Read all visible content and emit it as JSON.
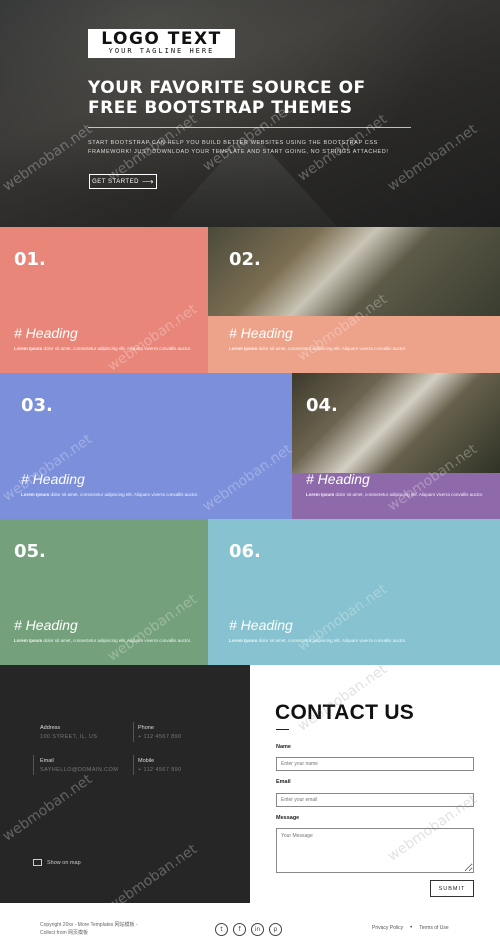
{
  "hero": {
    "logo_main": "LOGO TEXT",
    "logo_tagline": "YOUR TAGLINE HERE",
    "headline": "YOUR FAVORITE SOURCE OF FREE BOOTSTRAP THEMES",
    "description": "START BOOTSTRAP CAN HELP YOU BUILD BETTER WEBSITES USING THE BOOTSTRAP CSS FRAMEWORK! JUST DOWNLOAD YOUR TEMPLATE AND START GOING, NO STRINGS ATTACHED!",
    "cta_label": "GET STARTED",
    "cta_icon": "arrow-right-icon"
  },
  "tiles": [
    {
      "number": "01.",
      "heading": "# Heading",
      "lead": "Lorem Ipsum",
      "text": "dolor sit amet, consectetur adipiscing elit. Aliquam viverra convallis auctor.",
      "color": "#e9867a"
    },
    {
      "number": "02.",
      "heading": "# Heading",
      "lead": "Lorem Ipsum",
      "text": "dolor sit amet, consectetur adipiscing elit. Aliquam viverra convallis auctor.",
      "color": "#eda28a"
    },
    {
      "number": "03.",
      "heading": "# Heading",
      "lead": "Lorem Ipsum",
      "text": "dolor sit amet, consectetur adipiscing elit. Aliquam viverra convallis auctor.",
      "color": "#7b8fdb"
    },
    {
      "number": "04.",
      "heading": "# Heading",
      "lead": "Lorem Ipsum",
      "text": "dolor sit amet, consectetur adipiscing elit. Aliquam viverra convallis auctor.",
      "color": "#8e6aaa"
    },
    {
      "number": "05.",
      "heading": "# Heading",
      "lead": "Lorem Ipsum",
      "text": "dolor sit amet, consectetur adipiscing elit. Aliquam viverra convallis auctor.",
      "color": "#74a07b"
    },
    {
      "number": "06.",
      "heading": "# Heading",
      "lead": "Lorem Ipsum",
      "text": "dolor sit amet, consectetur adipiscing elit. Aliquam viverra convallis auctor.",
      "color": "#86c2cf"
    }
  ],
  "contact_info": {
    "address_label": "Address",
    "address_value": "100 STREET, IL, US",
    "phone_label": "Phone",
    "phone_value": "+ 112 4567 890",
    "email_label": "Email",
    "email_value": "SAYHELLO@DOMAIN.COM",
    "mobile_label": "Mobile",
    "mobile_value": "+ 112 4567 890",
    "show_map_label": "Show on map"
  },
  "contact_form": {
    "title": "CONTACT US",
    "name_label": "Name",
    "name_placeholder": "Enter your name",
    "email_label": "Email",
    "email_placeholder": "Enter your email",
    "message_label": "Message",
    "message_placeholder": "Your Message",
    "submit_label": "SUBMIT"
  },
  "footer": {
    "copyright": "Copyright 20xx - More Templates 网站模板 - Collect from 网页模板",
    "socials": [
      {
        "icon": "twitter-icon",
        "glyph": "t"
      },
      {
        "icon": "facebook-icon",
        "glyph": "f"
      },
      {
        "icon": "linkedin-icon",
        "glyph": "in"
      },
      {
        "icon": "pinterest-icon",
        "glyph": "p"
      }
    ],
    "privacy_label": "Privacy Policy",
    "terms_label": "Terms of Use"
  },
  "watermark": "webmoban.net"
}
